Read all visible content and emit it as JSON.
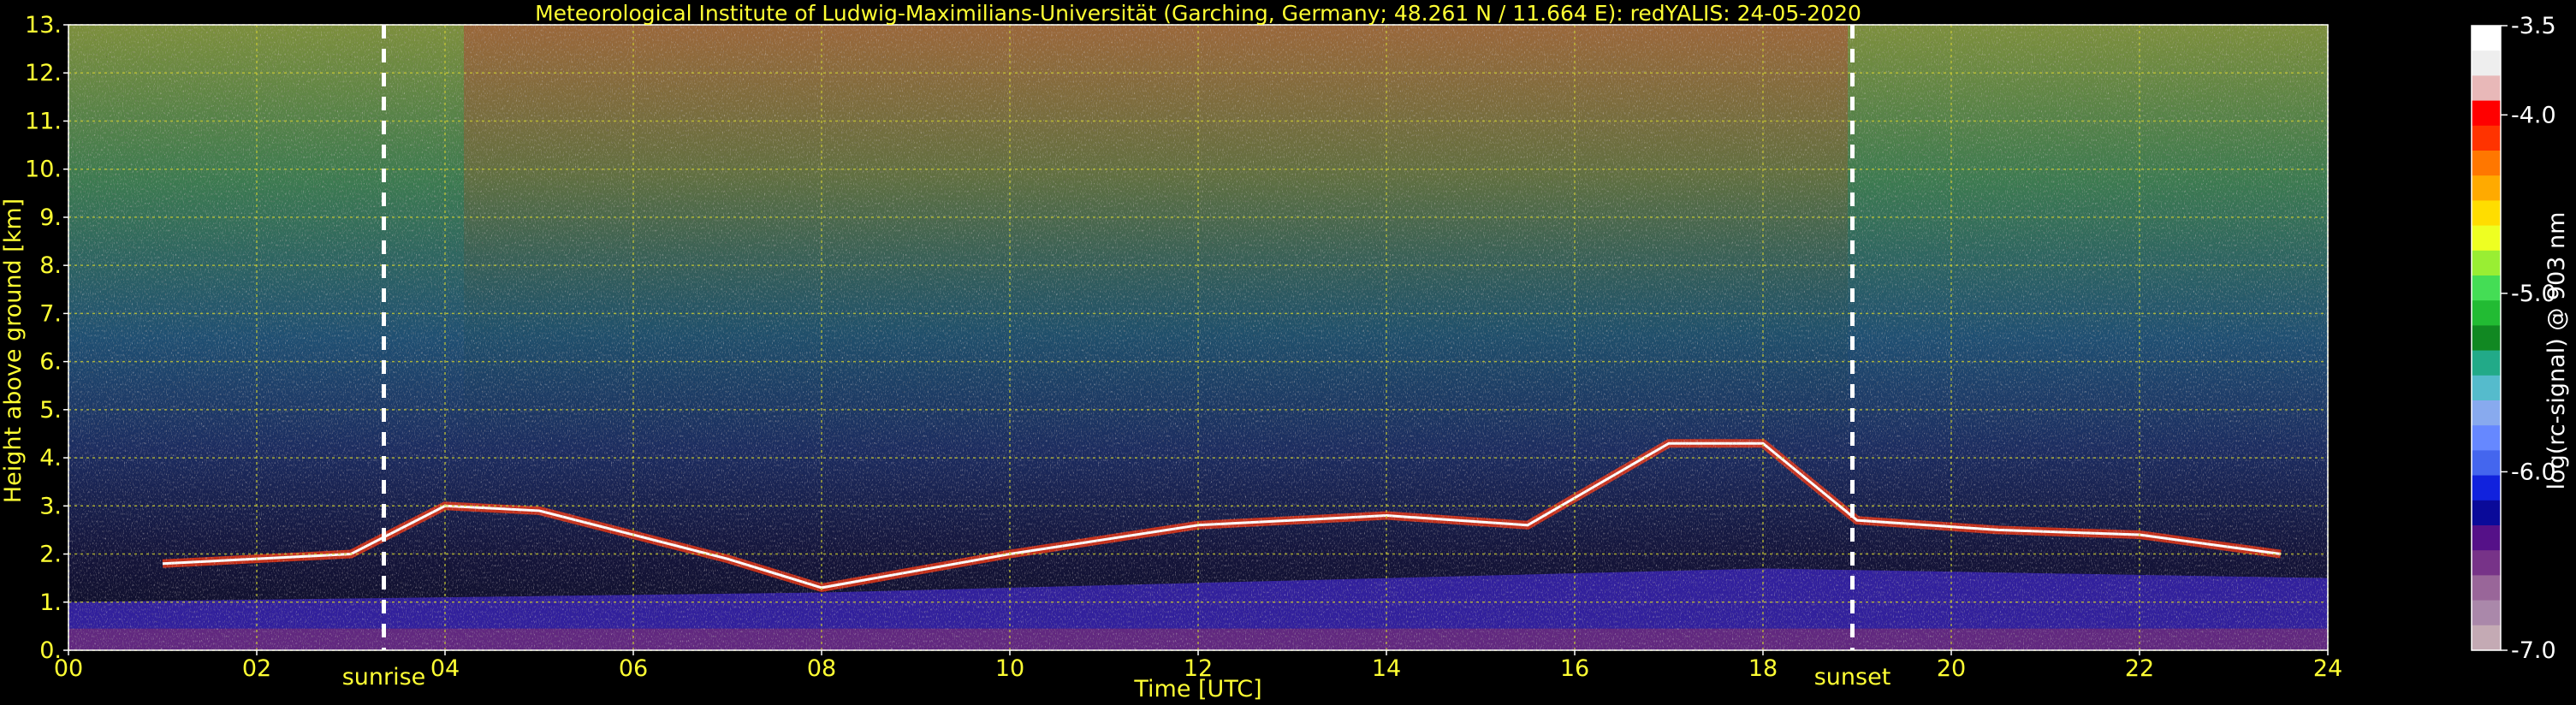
{
  "chart_data": {
    "type": "heatmap",
    "title": "Meteorological Institute of Ludwig-Maximilians-Universität (Garching, Germany; 48.261 N / 11.664 E):    redYALIS: 24-05-2020",
    "xlabel": "Time [UTC]",
    "ylabel": "Height above ground [km]",
    "xlim": [
      0,
      24
    ],
    "ylim": [
      0,
      13
    ],
    "x_ticks": [
      "00",
      "02",
      "04",
      "06",
      "08",
      "10",
      "12",
      "14",
      "16",
      "18",
      "20",
      "22",
      "24"
    ],
    "y_ticks": [
      "0.",
      "1.",
      "2.",
      "3.",
      "4.",
      "5.",
      "6.",
      "7.",
      "8.",
      "9.",
      "10.",
      "11.",
      "12.",
      "13."
    ],
    "grid": true,
    "events": [
      {
        "label": "sunrise",
        "time": 3.35
      },
      {
        "label": "sunset",
        "time": 18.95
      }
    ],
    "colorbar": {
      "label": "log(rc-signal) @ 903 nm",
      "range": [
        -7.0,
        -3.5
      ],
      "ticks": [
        "-3.5",
        "-4.0",
        "-5.0",
        "-6.0",
        "-7.0"
      ],
      "tick_values": [
        -3.5,
        -4.0,
        -5.0,
        -6.0,
        -7.0
      ],
      "colors": [
        "#ffffff",
        "#eeeeee",
        "#e8b8b8",
        "#ff0000",
        "#ff3300",
        "#ff7700",
        "#ffaa00",
        "#ffdd00",
        "#eeff22",
        "#99ee33",
        "#44dd55",
        "#22bb33",
        "#118822",
        "#22aa88",
        "#55bbcc",
        "#88aaee",
        "#6688ff",
        "#4466ee",
        "#1122dd",
        "#0a0a99",
        "#551188",
        "#773388",
        "#996699",
        "#aa88aa",
        "#c4aab4"
      ]
    },
    "features": {
      "cloud_layer_km": [
        {
          "t": 1.0,
          "h": 1.8
        },
        {
          "t": 2.0,
          "h": 1.9
        },
        {
          "t": 3.0,
          "h": 2.0
        },
        {
          "t": 4.0,
          "h": 3.0
        },
        {
          "t": 5.0,
          "h": 2.9
        },
        {
          "t": 6.0,
          "h": 2.4
        },
        {
          "t": 7.0,
          "h": 1.9
        },
        {
          "t": 8.0,
          "h": 1.3
        },
        {
          "t": 10.0,
          "h": 2.0
        },
        {
          "t": 12.0,
          "h": 2.6
        },
        {
          "t": 14.0,
          "h": 2.8
        },
        {
          "t": 15.5,
          "h": 2.6
        },
        {
          "t": 17.0,
          "h": 4.3
        },
        {
          "t": 18.0,
          "h": 4.3
        },
        {
          "t": 19.0,
          "h": 2.7
        },
        {
          "t": 20.5,
          "h": 2.5
        },
        {
          "t": 22.0,
          "h": 2.4
        },
        {
          "t": 23.5,
          "h": 2.0
        }
      ],
      "boundary_layer_km": [
        {
          "t": 0.0,
          "h": 1.0
        },
        {
          "t": 4.0,
          "h": 1.1
        },
        {
          "t": 8.0,
          "h": 1.2
        },
        {
          "t": 12.0,
          "h": 1.4
        },
        {
          "t": 16.0,
          "h": 1.6
        },
        {
          "t": 18.0,
          "h": 1.7
        },
        {
          "t": 24.0,
          "h": 1.5
        }
      ]
    }
  }
}
